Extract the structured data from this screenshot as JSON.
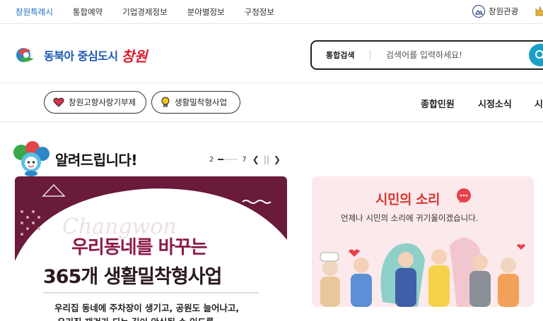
{
  "topnav": {
    "items": [
      "창원특례시",
      "통합예약",
      "기업경제정보",
      "분야별정보",
      "구청정보"
    ],
    "tourism": "창원관광"
  },
  "header": {
    "slogan": "동북아 중심도시",
    "city": "창원",
    "search": {
      "label": "통합검색",
      "placeholder": "검색어를 입력하세요!"
    }
  },
  "quicklinks": [
    "창원고향사랑기부제",
    "생활밀착형사업"
  ],
  "mainmenu": [
    "종합민원",
    "시정소식",
    "시"
  ],
  "notice": {
    "title": "알려드립니다!",
    "pager_current": "2",
    "pager_total": "7"
  },
  "banner": {
    "brand": "Changwon",
    "line1": "우리동네를 바꾸는",
    "line2": "365개 생활밀착형사업",
    "line3": "우리집 동네에 주차장이 생기고, 공원도 늘어나고,",
    "line4": "우리집 재건가 되는 길이 안심될 수 있도록"
  },
  "voice": {
    "title": "시민의 소리",
    "subtitle": "언제나 시민의 소리에 귀기울이겠습니다."
  },
  "colors": {
    "accent": "#1b6fc3",
    "search_button": "#1aa0c8",
    "banner_bg": "#6a1a3a",
    "voice_bg": "#fbe9ec",
    "voice_title": "#d8362f"
  },
  "icons": [
    "camera-icon",
    "crown-icon",
    "search-icon",
    "heart-icon",
    "lightbulb-icon",
    "chevron-left-icon",
    "pause-icon",
    "chevron-right-icon",
    "chat-bubble-icon",
    "mascot-icon",
    "logo-mark"
  ]
}
